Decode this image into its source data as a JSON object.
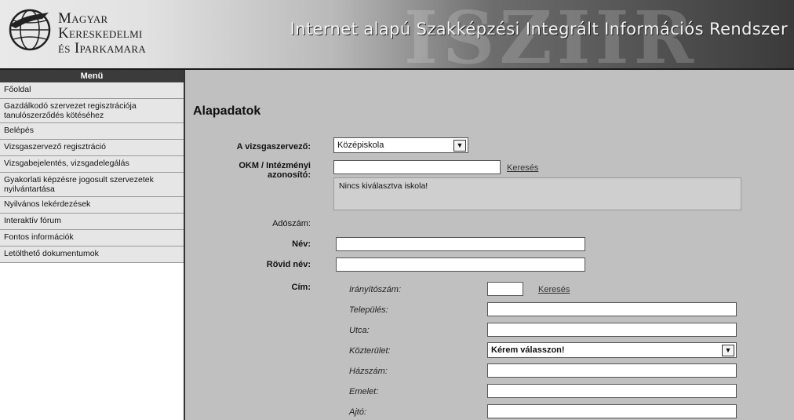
{
  "header": {
    "org_lines": [
      "Magyar",
      "Kereskedelmi",
      "és Iparkamara"
    ],
    "watermark": "ISZIIR",
    "system_title": "Internet alapú Szakképzési Integrált Információs Rendszer"
  },
  "sidebar": {
    "title": "Menü",
    "items": [
      {
        "label": "Főoldal"
      },
      {
        "label": "Gazdálkodó szervezet regisztrációja tanulószerződés kötéséhez"
      },
      {
        "label": "Belépés"
      },
      {
        "label": "Vizsgaszervező regisztráció"
      },
      {
        "label": "Vizsgabejelentés, vizsgadelegálás"
      },
      {
        "label": "Gyakorlati képzésre jogosult szervezetek nyilvántartása"
      },
      {
        "label": "Nyilvános lekérdezések"
      },
      {
        "label": "Interaktív fórum"
      },
      {
        "label": "Fontos információk"
      },
      {
        "label": "Letölthető dokumentumok"
      }
    ]
  },
  "main": {
    "heading": "Alapadatok",
    "organizer": {
      "label": "A vizsgaszervező:",
      "value": "Középiskola"
    },
    "okm": {
      "label_line1": "OKM / Intézményi",
      "label_line2": "azonosító:",
      "value": "",
      "search_link": "Keresés",
      "info": "Nincs kiválasztva iskola!"
    },
    "tax": {
      "label": "Adószám:"
    },
    "name": {
      "label": "Név:",
      "value": ""
    },
    "short_name": {
      "label": "Rövid név:",
      "value": ""
    },
    "address": {
      "label": "Cím:",
      "zip": {
        "label": "Irányítószám:",
        "value": "",
        "search_link": "Keresés"
      },
      "city": {
        "label": "Település:",
        "value": ""
      },
      "street": {
        "label": "Utca:",
        "value": ""
      },
      "public_area": {
        "label": "Közterület:",
        "value": "Kérem válasszon!"
      },
      "house_no": {
        "label": "Házszám:",
        "value": ""
      },
      "floor": {
        "label": "Emelet:",
        "value": ""
      },
      "door": {
        "label": "Ajtó:",
        "value": ""
      }
    }
  }
}
